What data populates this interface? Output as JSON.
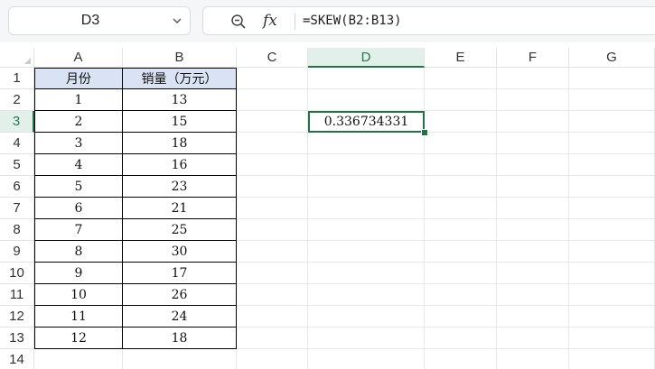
{
  "namebox": {
    "value": "D3"
  },
  "formula_bar": {
    "zoom_icon": "zoom-magnifier-icon",
    "fx_label": "fx",
    "formula": "=SKEW(B2:B13)"
  },
  "columns": [
    "A",
    "B",
    "C",
    "D",
    "E",
    "F",
    "G"
  ],
  "active_column": "D",
  "rows": [
    "1",
    "2",
    "3",
    "4",
    "5",
    "6",
    "7",
    "8",
    "9",
    "10",
    "11",
    "12",
    "13",
    "14"
  ],
  "active_row": "3",
  "table": {
    "headers": [
      "月份",
      "销量（万元）"
    ],
    "rows": [
      [
        "1",
        "13"
      ],
      [
        "2",
        "15"
      ],
      [
        "3",
        "18"
      ],
      [
        "4",
        "16"
      ],
      [
        "5",
        "23"
      ],
      [
        "6",
        "21"
      ],
      [
        "7",
        "25"
      ],
      [
        "8",
        "30"
      ],
      [
        "9",
        "17"
      ],
      [
        "10",
        "26"
      ],
      [
        "11",
        "24"
      ],
      [
        "12",
        "18"
      ]
    ]
  },
  "selected_cell": {
    "address": "D3",
    "value": "0.336734331"
  },
  "colors": {
    "accent": "#217346",
    "header_fill": "#dae3f3",
    "active_header_fill": "#e3f0ea"
  }
}
